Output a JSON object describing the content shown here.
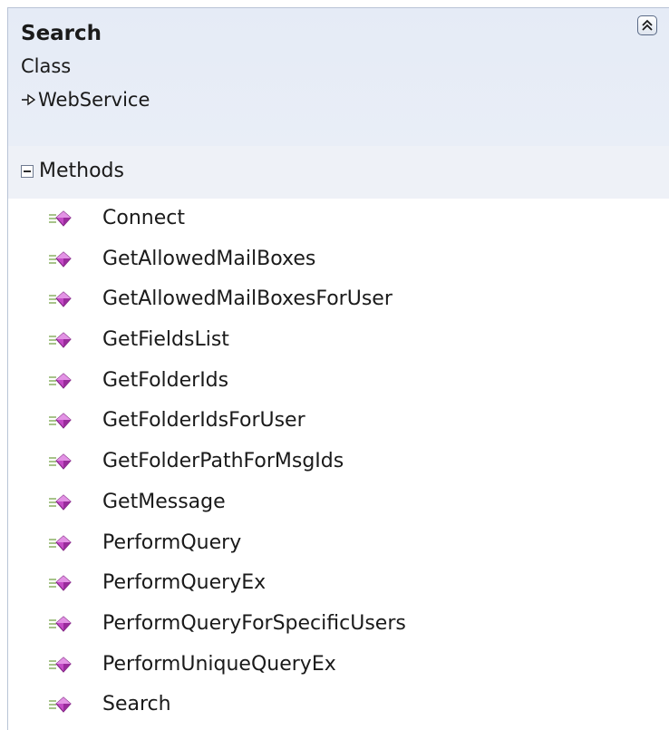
{
  "class_box": {
    "title": "Search",
    "kind": "Class",
    "base_type": "WebService",
    "collapse_icon": "double-chevron-up-icon"
  },
  "methods_section": {
    "label": "Methods",
    "toggle_icon": "collapse-minus-icon",
    "items": [
      {
        "label": "Connect",
        "icon": "public-method-icon"
      },
      {
        "label": "GetAllowedMailBoxes",
        "icon": "public-method-icon"
      },
      {
        "label": "GetAllowedMailBoxesForUser",
        "icon": "public-method-icon"
      },
      {
        "label": "GetFieldsList",
        "icon": "public-method-icon"
      },
      {
        "label": "GetFolderIds",
        "icon": "public-method-icon"
      },
      {
        "label": "GetFolderIdsForUser",
        "icon": "public-method-icon"
      },
      {
        "label": "GetFolderPathForMsgIds",
        "icon": "public-method-icon"
      },
      {
        "label": "GetMessage",
        "icon": "public-method-icon"
      },
      {
        "label": "PerformQuery",
        "icon": "public-method-icon"
      },
      {
        "label": "PerformQueryEx",
        "icon": "public-method-icon"
      },
      {
        "label": "PerformQueryForSpecificUsers",
        "icon": "public-method-icon"
      },
      {
        "label": "PerformUniqueQueryEx",
        "icon": "public-method-icon"
      },
      {
        "label": "Search",
        "icon": "public-method-icon"
      }
    ]
  },
  "colors": {
    "header_bg": "#e7ecf6",
    "section_bg": "#eef1f7",
    "method_icon": "#b23fb5",
    "border": "#b9c4d6"
  }
}
